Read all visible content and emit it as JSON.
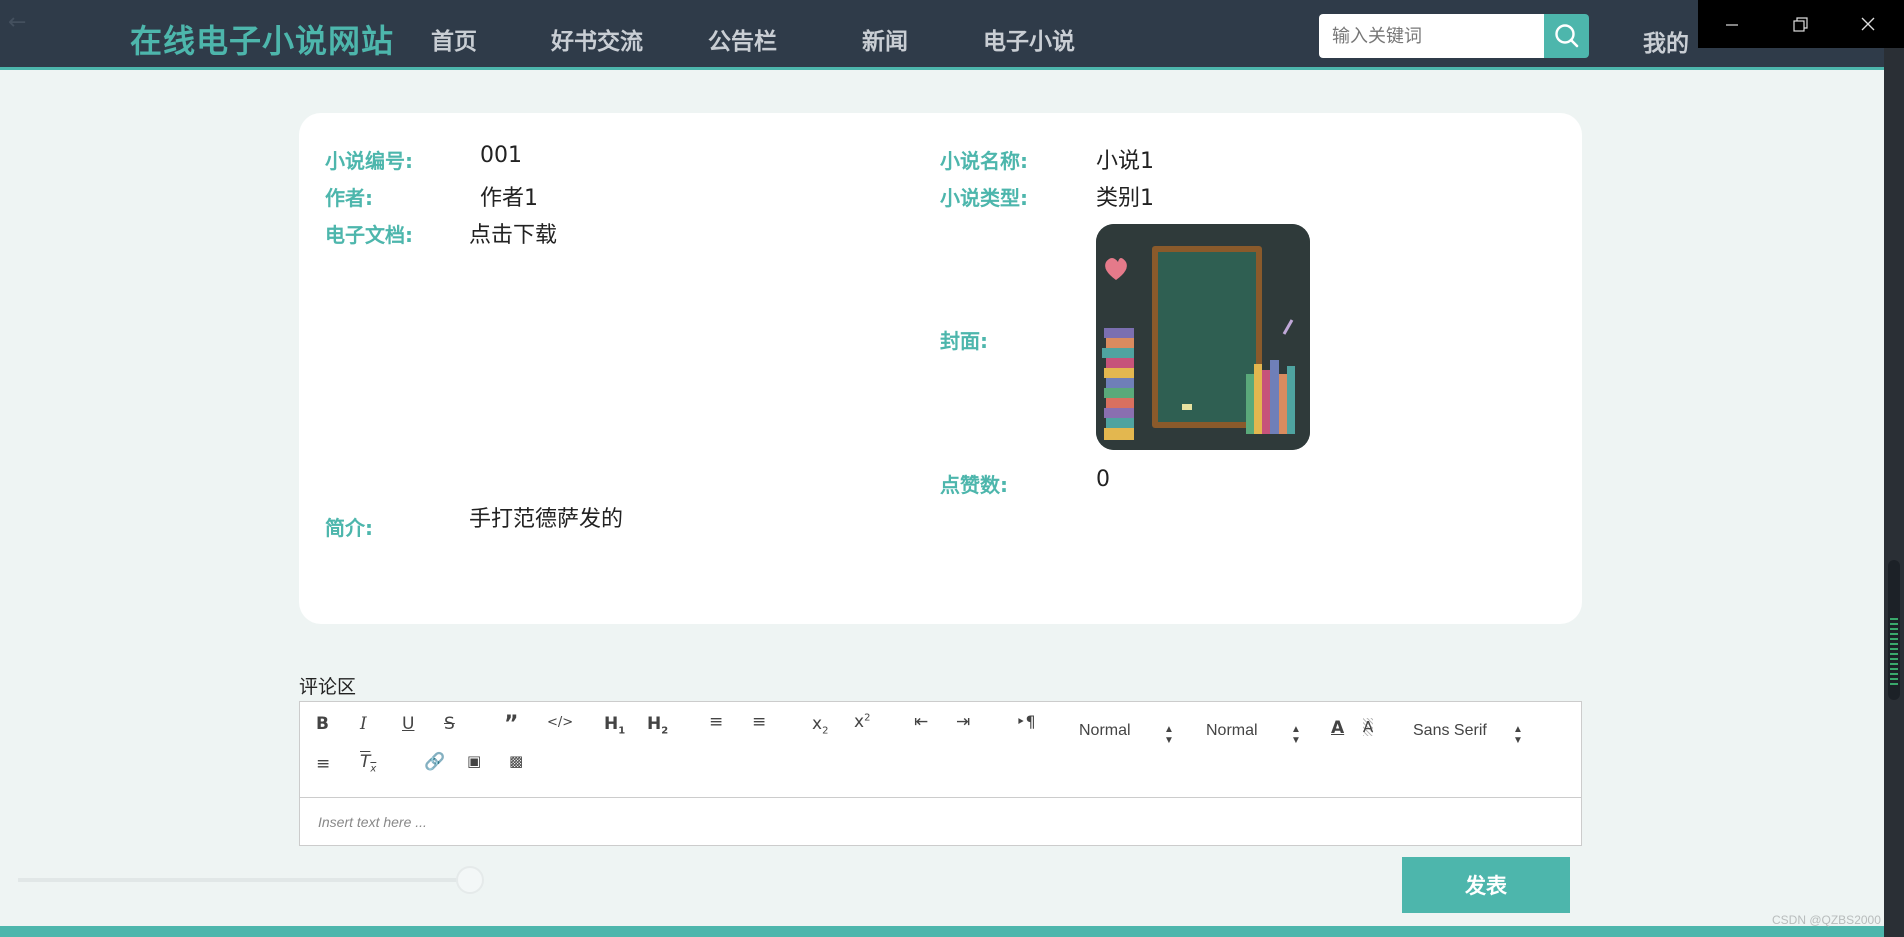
{
  "header": {
    "brand": "在线电子小说网站",
    "nav": [
      "首页",
      "好书交流",
      "公告栏",
      "新闻",
      "电子小说"
    ],
    "search_placeholder": "输入关键词",
    "user_menu": "我的"
  },
  "detail": {
    "novel_id_label": "小说编号:",
    "novel_id": "001",
    "name_label": "小说名称:",
    "name": "小说1",
    "author_label": "作者:",
    "author": "作者1",
    "type_label": "小说类型:",
    "type": "类别1",
    "doc_label": "电子文档:",
    "doc_link": "点击下载",
    "cover_label": "封面:",
    "likes_label": "点赞数:",
    "likes": "0",
    "intro_label": "简介:",
    "intro": "手打范德萨发的"
  },
  "comments": {
    "title": "评论区",
    "toolbar": {
      "header_select": "Normal",
      "size_select": "Normal",
      "font_select": "Sans Serif"
    },
    "placeholder": "Insert text here ...",
    "submit_label": "发表"
  },
  "watermark": "CSDN @QZBS2000",
  "colors": {
    "accent": "#4db6ac",
    "nav_bg": "#2f3b49",
    "page_bg": "#eef4f3"
  }
}
